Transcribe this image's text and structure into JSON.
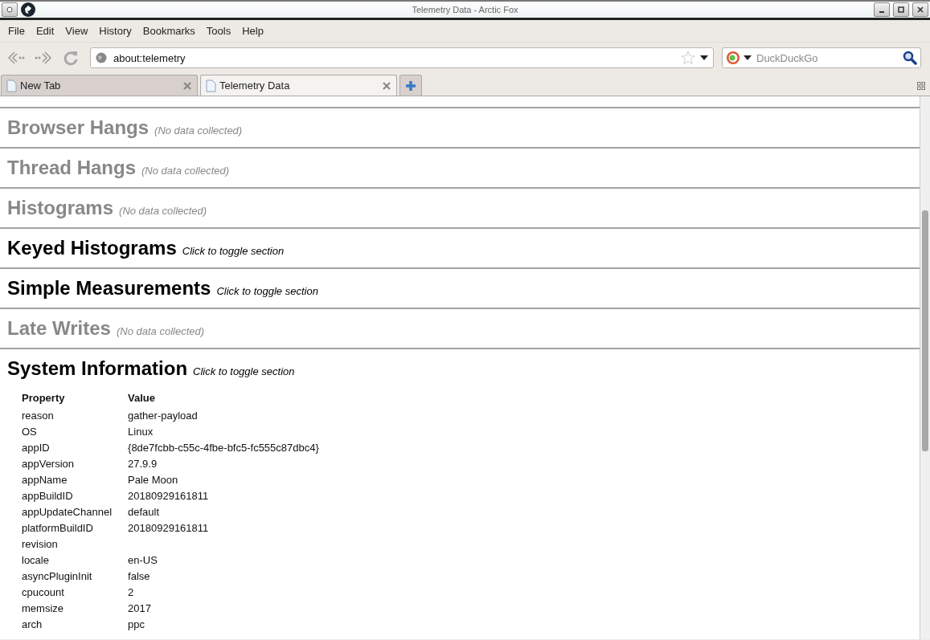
{
  "window": {
    "title": "Telemetry Data - Arctic Fox"
  },
  "menu": [
    "File",
    "Edit",
    "View",
    "History",
    "Bookmarks",
    "Tools",
    "Help"
  ],
  "address": {
    "value": "about:telemetry"
  },
  "search": {
    "placeholder": "DuckDuckGo"
  },
  "tabs": [
    {
      "label": "New Tab",
      "selected": false
    },
    {
      "label": "Telemetry Data",
      "selected": true
    }
  ],
  "sections": [
    {
      "title": "Browser Hangs",
      "note": "(No data collected)",
      "disabled": true
    },
    {
      "title": "Thread Hangs",
      "note": "(No data collected)",
      "disabled": true
    },
    {
      "title": "Histograms",
      "note": "(No data collected)",
      "disabled": true
    },
    {
      "title": "Keyed Histograms",
      "note": "Click to toggle section",
      "disabled": false
    },
    {
      "title": "Simple Measurements",
      "note": "Click to toggle section",
      "disabled": false
    },
    {
      "title": "Late Writes",
      "note": "(No data collected)",
      "disabled": true
    },
    {
      "title": "System Information",
      "note": "Click to toggle section",
      "disabled": false
    }
  ],
  "table": {
    "columns": [
      "Property",
      "Value"
    ],
    "rows": [
      [
        "reason",
        "gather-payload"
      ],
      [
        "OS",
        "Linux"
      ],
      [
        "appID",
        "{8de7fcbb-c55c-4fbe-bfc5-fc555c87dbc4}"
      ],
      [
        "appVersion",
        "27.9.9"
      ],
      [
        "appName",
        "Pale Moon"
      ],
      [
        "appBuildID",
        "20180929161811"
      ],
      [
        "appUpdateChannel",
        "default"
      ],
      [
        "platformBuildID",
        "20180929161811"
      ],
      [
        "revision",
        ""
      ],
      [
        "locale",
        "en-US"
      ],
      [
        "asyncPluginInit",
        "false"
      ],
      [
        "cpucount",
        "2"
      ],
      [
        "memsize",
        "2017"
      ],
      [
        "arch",
        "ppc"
      ]
    ]
  }
}
